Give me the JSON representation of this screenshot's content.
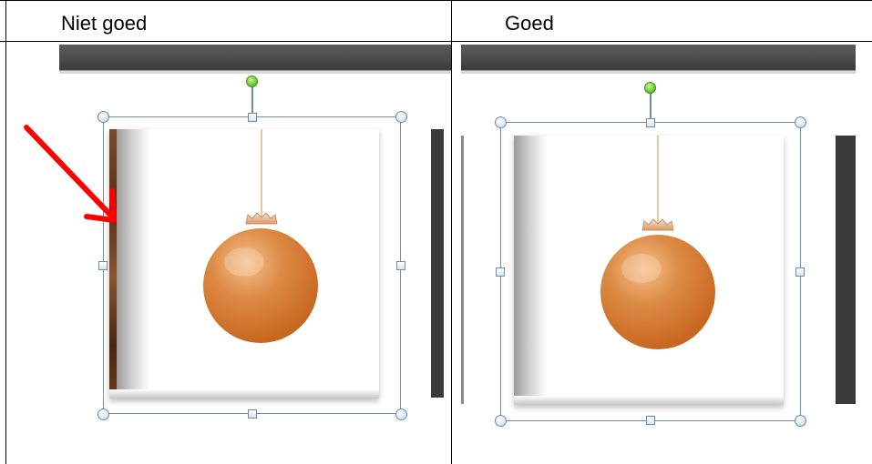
{
  "table": {
    "columns": [
      {
        "header": "Niet goed"
      },
      {
        "header": "Goed"
      }
    ]
  },
  "colors": {
    "selection_border": "#6d8bab",
    "rotate_handle": "#6ecb2e",
    "ornament": "#d4782d",
    "arrow": "#ff0000",
    "toolbar": "#4a4a4a"
  },
  "icons": {
    "arrow": "red-arrow-icon",
    "ornament": "christmas-ornament-icon"
  }
}
